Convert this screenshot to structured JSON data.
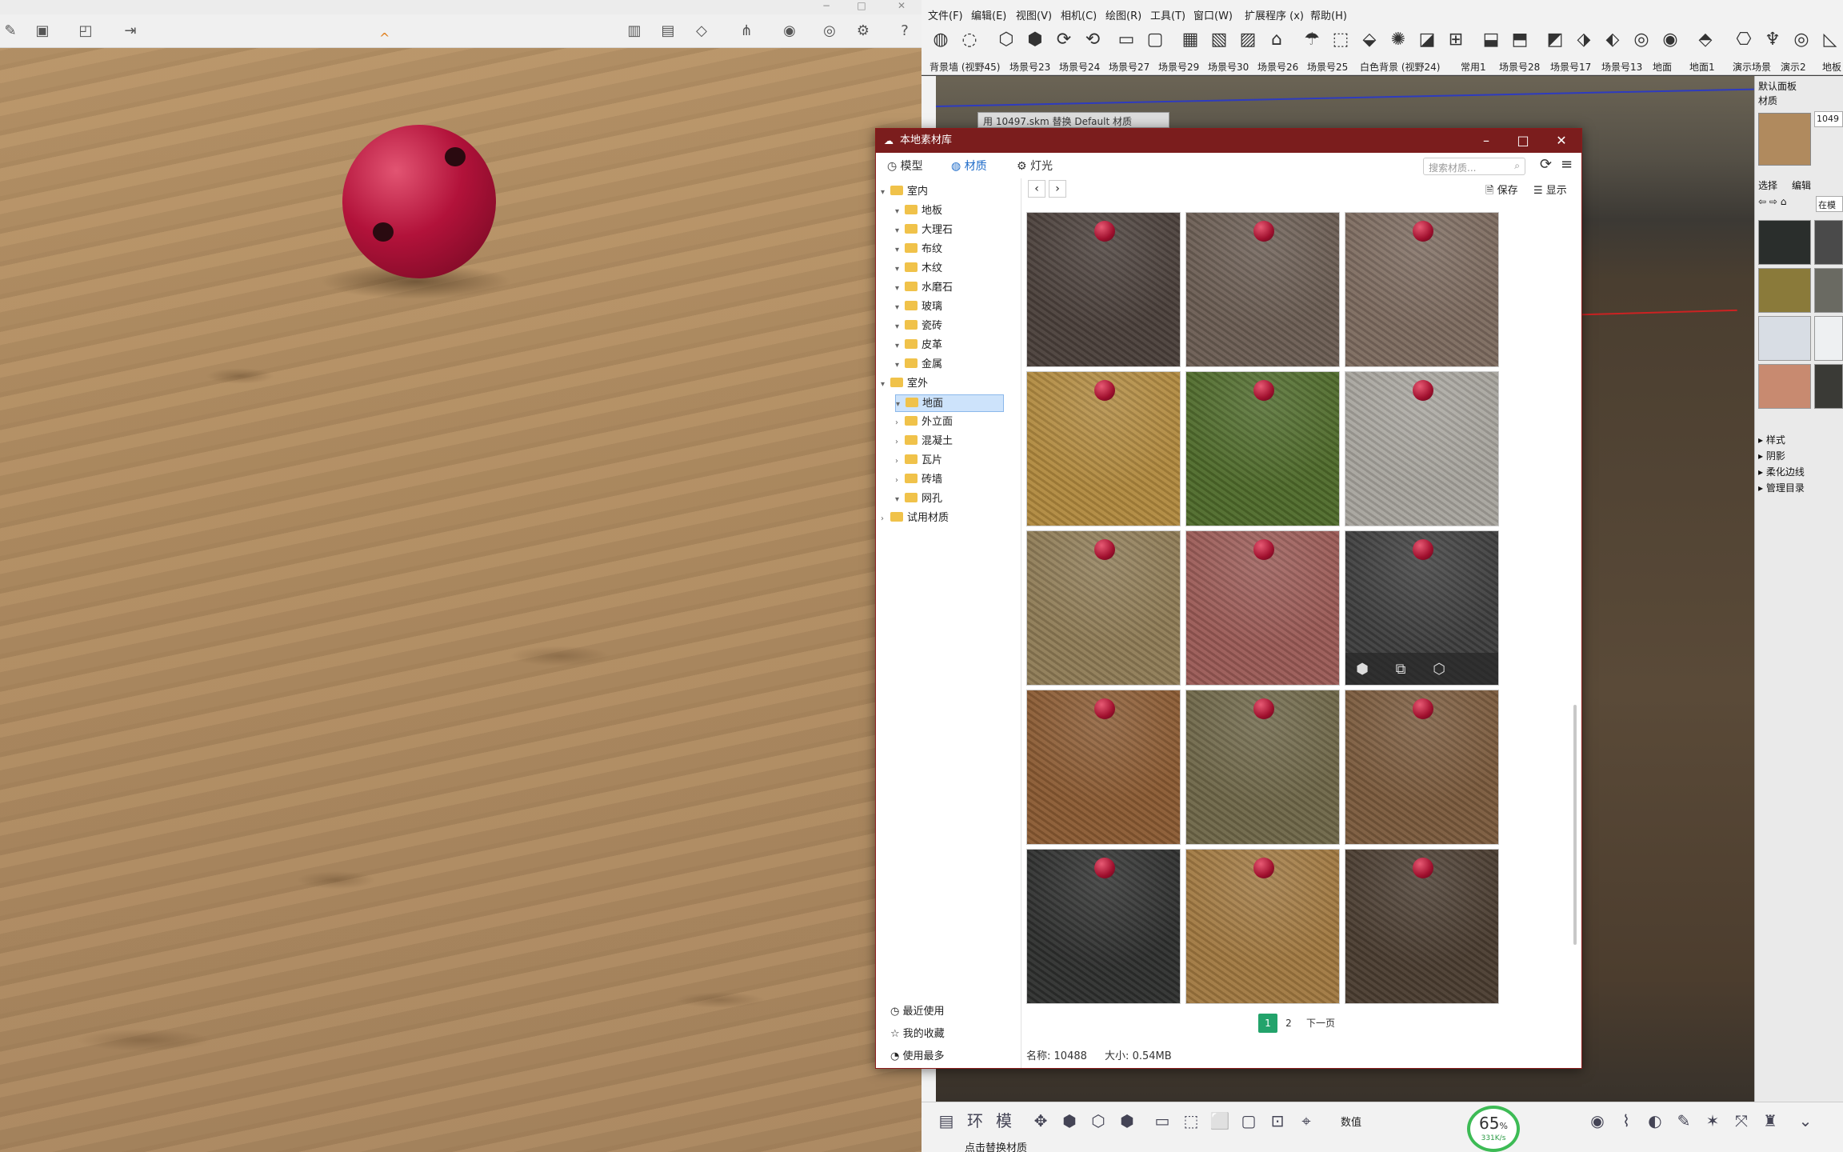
{
  "render_window": {
    "window_controls": [
      "−",
      "□",
      "✕"
    ]
  },
  "sketchup": {
    "menu": [
      "文件(F)",
      "编辑(E)",
      "视图(V)",
      "相机(C)",
      "绘图(R)",
      "工具(T)",
      "窗口(W)",
      "扩展程序 (x)",
      "帮助(H)"
    ],
    "scenes": [
      "背景墙 (视野45)",
      "场景号23",
      "场景号24",
      "场景号27",
      "场景号29",
      "场景号30",
      "场景号26",
      "场景号25",
      "白色背景 (视野24)",
      "常用1",
      "场景号28",
      "场景号17",
      "场景号13",
      "地面",
      "地面1",
      "演示场景",
      "演示2",
      "地板"
    ],
    "viewport_bar": "用 10497.skm 替换 Default 材质",
    "tray": {
      "title": "默认面板",
      "materials": "材质",
      "id_field": "1049",
      "select_tab": "选择",
      "edit_tab": "编辑",
      "in_model": "在模",
      "sections": [
        "样式",
        "阴影",
        "柔化边线",
        "管理目录"
      ]
    },
    "status": {
      "value_label": "数值",
      "hint": "点击替换材质",
      "gauge_percent": "65",
      "gauge_rate": "331K/s"
    }
  },
  "dialog": {
    "title": "本地素材库",
    "tabs": {
      "model": "模型",
      "material": "材质",
      "light": "灯光"
    },
    "search_placeholder": "搜索材质...",
    "save": "保存",
    "display": "显示",
    "tree": [
      {
        "label": "室内",
        "level": 0,
        "toggle": "▾"
      },
      {
        "label": "地板",
        "level": 1,
        "toggle": "▾"
      },
      {
        "label": "大理石",
        "level": 1,
        "toggle": "▾"
      },
      {
        "label": "布纹",
        "level": 1,
        "toggle": "▾"
      },
      {
        "label": "木纹",
        "level": 1,
        "toggle": "▾"
      },
      {
        "label": "水磨石",
        "level": 1,
        "toggle": "▾"
      },
      {
        "label": "玻璃",
        "level": 1,
        "toggle": "▾"
      },
      {
        "label": "瓷砖",
        "level": 1,
        "toggle": "▾"
      },
      {
        "label": "皮革",
        "level": 1,
        "toggle": "▾"
      },
      {
        "label": "金属",
        "level": 1,
        "toggle": "▾"
      },
      {
        "label": "室外",
        "level": 0,
        "toggle": "▾"
      },
      {
        "label": "地面",
        "level": 1,
        "toggle": "▾",
        "selected": true
      },
      {
        "label": "外立面",
        "level": 1,
        "toggle": "›"
      },
      {
        "label": "混凝土",
        "level": 1,
        "toggle": "›"
      },
      {
        "label": "瓦片",
        "level": 1,
        "toggle": "›"
      },
      {
        "label": "砖墙",
        "level": 1,
        "toggle": "›"
      },
      {
        "label": "网孔",
        "level": 1,
        "toggle": "▾"
      },
      {
        "label": "试用材质",
        "level": 0,
        "toggle": "›"
      }
    ],
    "side_links": [
      "最近使用",
      "我的收藏",
      "使用最多"
    ],
    "tiles": [
      "#4a3f3a",
      "#6a5c52",
      "#7c6a5e",
      "#b0893e",
      "#4e6a2a",
      "#a7a49d",
      "#8e7b55",
      "#9a5a55",
      "#3d3d3d",
      "#8a5a32",
      "#6e6648",
      "#7a5a3c",
      "#2e2f2e",
      "#a07840",
      "#4a3c30"
    ],
    "pager": {
      "pages": [
        "1",
        "2"
      ],
      "next": "下一页"
    },
    "info": {
      "name_label": "名称:",
      "name_value": "10488",
      "size_label": "大小:",
      "size_value": "0.54MB"
    }
  }
}
